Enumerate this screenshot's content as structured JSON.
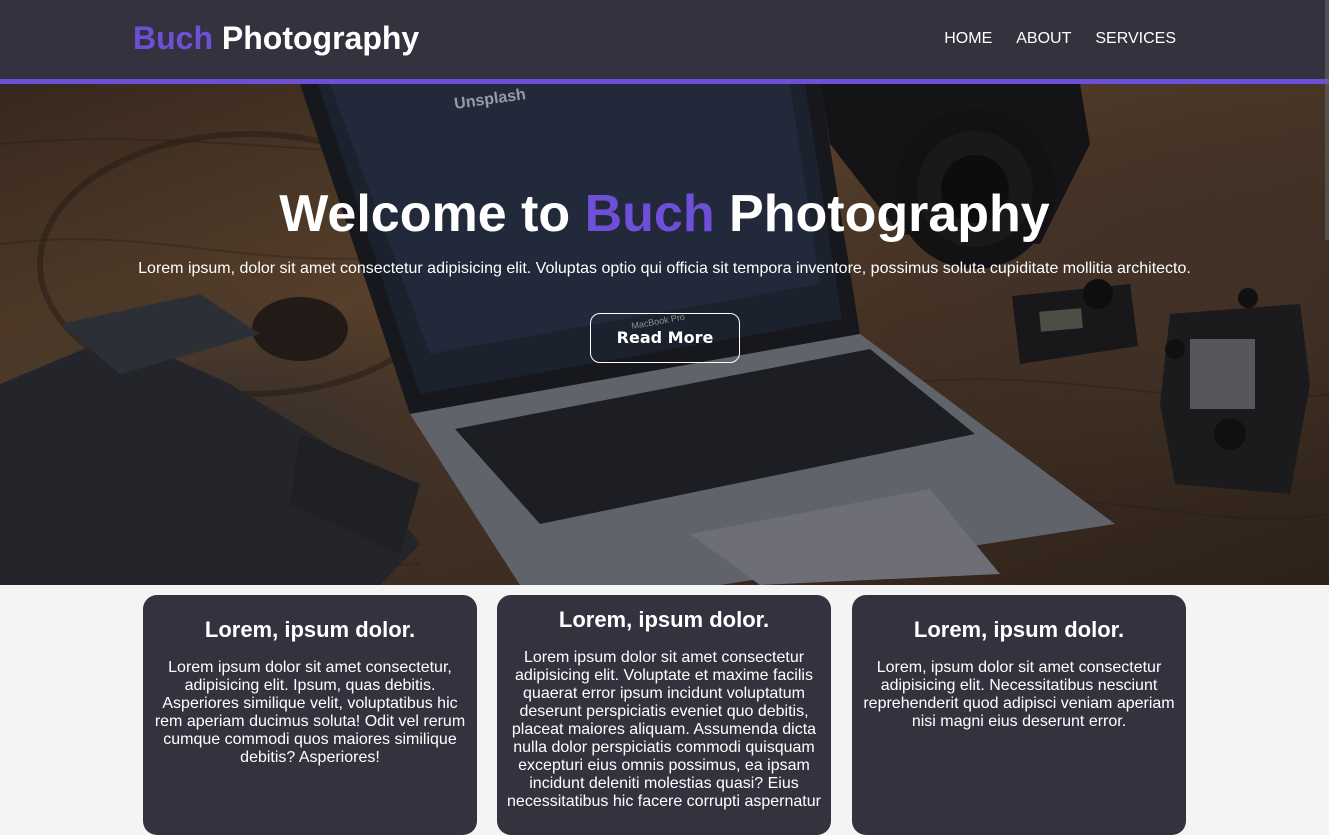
{
  "header": {
    "brand_accent": "Buch",
    "brand_rest": " Photography",
    "nav": [
      "HOME",
      "ABOUT",
      "SERVICES"
    ]
  },
  "hero": {
    "title_pre": "Welcome to ",
    "title_accent": "Buch",
    "title_post": " Photography",
    "text": "Lorem ipsum, dolor sit amet consectetur adipisicing elit. Voluptas optio qui officia sit tempora inventore, possimus soluta cupiditate mollitia architecto.",
    "button_label": "Read More",
    "background_image": "laptop-camera-desk-photo",
    "screen_text": "Unsplash",
    "laptop_label": "MacBook Pro"
  },
  "cards": [
    {
      "title": "Lorem, ipsum dolor.",
      "text": "Lorem ipsum dolor sit amet consectetur, adipisicing elit. Ipsum, quas debitis. Asperiores similique velit, voluptatibus hic rem aperiam ducimus soluta! Odit vel rerum cumque commodi quos maiores similique debitis? Asperiores!"
    },
    {
      "title": "Lorem, ipsum dolor.",
      "text": "Lorem ipsum dolor sit amet consectetur adipisicing elit. Voluptate et maxime facilis quaerat error ipsum incidunt voluptatum deserunt perspiciatis eveniet quo debitis, placeat maiores aliquam. Assumenda dicta nulla dolor perspiciatis commodi quisquam excepturi eius omnis possimus, ea ipsam incidunt deleniti molestias quasi? Eius necessitatibus hic facere corrupti aspernatur"
    },
    {
      "title": "Lorem, ipsum dolor.",
      "text": "Lorem, ipsum dolor sit amet consectetur adipisicing elit. Necessitatibus nesciunt reprehenderit quod adipisci veniam aperiam nisi magni eius deserunt error."
    }
  ],
  "colors": {
    "accent": "#6e4fd8",
    "header_bg": "#35323f",
    "card_bg": "#35323f",
    "page_bg": "#f4f4f4"
  }
}
